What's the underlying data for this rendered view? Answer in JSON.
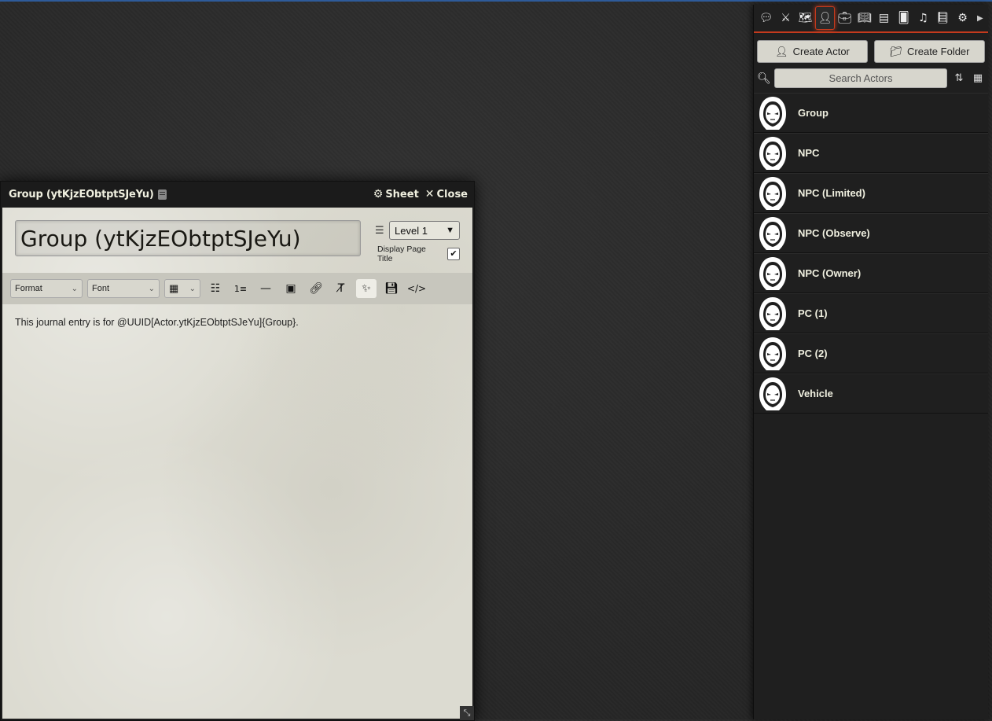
{
  "journal": {
    "window_title": "Group (ytKjzEObtptSJeYu)",
    "sheet_label": "Sheet",
    "close_label": "Close",
    "page_title": "Group (ytKjzEObtptSJeYu)",
    "level_value": "Level 1",
    "display_page_title_label": "Display Page Title",
    "toolbar": {
      "format_label": "Format",
      "font_label": "Font"
    },
    "content": "This journal entry is for @UUID[Actor.ytKjzEObtptSJeYu]{Group}."
  },
  "sidebar": {
    "tabs": [
      "chat-icon",
      "combat-icon",
      "scenes-icon",
      "actors-icon",
      "items-icon",
      "journal-icon",
      "tables-icon",
      "cards-icon",
      "playlists-icon",
      "compendium-icon",
      "settings-icon"
    ],
    "active_tab": "actors-icon",
    "create_actor_label": "Create Actor",
    "create_folder_label": "Create Folder",
    "search_placeholder": "Search Actors",
    "actors": [
      {
        "name": "Group"
      },
      {
        "name": "NPC"
      },
      {
        "name": "NPC (Limited)"
      },
      {
        "name": "NPC (Observe)"
      },
      {
        "name": "NPC (Owner)"
      },
      {
        "name": "PC (1)"
      },
      {
        "name": "PC (2)"
      },
      {
        "name": "Vehicle"
      }
    ]
  },
  "colors": {
    "accent": "#c43a1d",
    "parchment": "#dcdbd1"
  }
}
